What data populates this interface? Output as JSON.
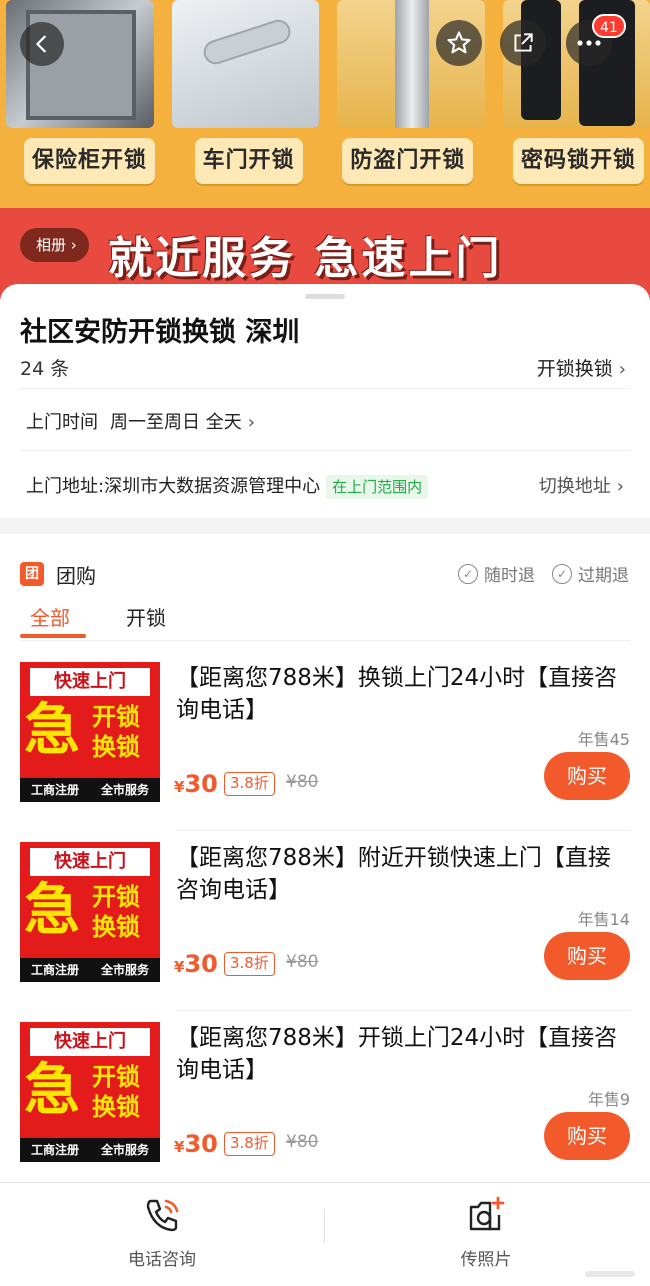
{
  "banner": {
    "labels": [
      "保险柜开锁",
      "车门开锁",
      "防盗门开锁",
      "密码锁开锁"
    ],
    "slogan": "就近服务 急速上门",
    "album_label": "相册 ›",
    "badge_count": "41"
  },
  "shop": {
    "title": "社区安防开锁换锁 深圳",
    "count": "24 条",
    "category": "开锁换锁",
    "hours_label": "上门时间",
    "hours_value": "周一至周日 全天",
    "address": "上门地址:深圳市大数据资源管理中心",
    "range_tag": "在上门范围内",
    "switch_address": "切换地址"
  },
  "group": {
    "icon": "团",
    "title": "团购",
    "policy1": "随时退",
    "policy2": "过期退",
    "tabs": [
      "全部",
      "开锁"
    ]
  },
  "deal_image": {
    "top": "快速上门",
    "big": "急",
    "small": "开锁换锁",
    "foot1": "工商注册",
    "foot2": "全市服务"
  },
  "deals": [
    {
      "title": "【距离您788米】换锁上门24小时【直接咨询电话】",
      "sold": "年售45",
      "currency": "¥",
      "price": "30",
      "discount": "3.8折",
      "original": "¥80",
      "buy": "购买"
    },
    {
      "title": "【距离您788米】附近开锁快速上门【直接咨询电话】",
      "sold": "年售14",
      "currency": "¥",
      "price": "30",
      "discount": "3.8折",
      "original": "¥80",
      "buy": "购买"
    },
    {
      "title": "【距离您788米】开锁上门24小时【直接咨询电话】",
      "sold": "年售9",
      "currency": "¥",
      "price": "30",
      "discount": "3.8折",
      "original": "¥80",
      "buy": "购买"
    }
  ],
  "bottom_bar": {
    "phone_label": "电话咨询",
    "photo_label": "传照片"
  },
  "colors": {
    "accent": "#f35a2b",
    "banner_bg": "#f5b13d",
    "slogan_bg": "#e94a3f",
    "range_green": "#1faa45"
  }
}
